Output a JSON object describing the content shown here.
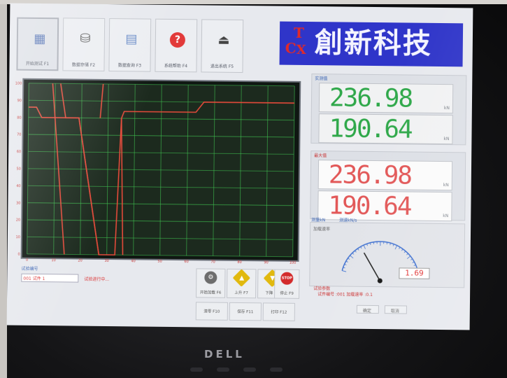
{
  "toolbar": {
    "buttons": [
      {
        "label": "开始测试 F1",
        "icon": "chart-icon",
        "symbol": "▦"
      },
      {
        "label": "数据存储 F2",
        "icon": "disk-icon",
        "symbol": "⛁"
      },
      {
        "label": "数据查询 F3",
        "icon": "document-icon",
        "symbol": "▤"
      },
      {
        "label": "系统帮助 F4",
        "icon": "help-icon",
        "symbol": "?"
      },
      {
        "label": "退出系统 F5",
        "icon": "exit-icon",
        "symbol": "⏏"
      }
    ]
  },
  "brand": {
    "logo_letters": [
      "T",
      "C",
      "X"
    ],
    "name": "創新科技"
  },
  "chart_data": {
    "type": "line",
    "title": "",
    "xlabel": "",
    "ylabel": "",
    "xlim": [
      0,
      100
    ],
    "ylim": [
      0,
      100
    ],
    "background": "#1c2a1e",
    "grid": true,
    "grid_color": "#3fbf4f",
    "x_ticks": [
      0,
      10,
      20,
      30,
      40,
      50,
      60,
      70,
      80,
      90,
      100
    ],
    "y_ticks": [
      0,
      10,
      20,
      30,
      40,
      50,
      60,
      70,
      80,
      90,
      100
    ],
    "series": [
      {
        "color": "#e54a3a",
        "points": [
          [
            0,
            86
          ],
          [
            3,
            86
          ],
          [
            5,
            80
          ],
          [
            10,
            80
          ],
          [
            19,
            80
          ],
          [
            27,
            0
          ],
          [
            33,
            0
          ],
          [
            35,
            80
          ],
          [
            36,
            84
          ],
          [
            63,
            84
          ],
          [
            66,
            90
          ],
          [
            100,
            90
          ]
        ]
      },
      {
        "color": "#e54a3a",
        "points": [
          [
            9,
            100
          ],
          [
            12,
            40
          ],
          [
            14,
            0
          ]
        ]
      },
      {
        "color": "#e54a3a",
        "points": [
          [
            12,
            100
          ],
          [
            14,
            80
          ],
          [
            19,
            80
          ],
          [
            27,
            0
          ]
        ]
      },
      {
        "color": "#e54a3a",
        "points": [
          [
            27,
            80
          ],
          [
            28,
            100
          ]
        ]
      },
      {
        "color": "#e54a3a",
        "points": [
          [
            35,
            80
          ],
          [
            36,
            0
          ]
        ]
      }
    ]
  },
  "panel_measured": {
    "title": "实测值",
    "value1": "236.98",
    "value2": "190.64",
    "unit": "kN"
  },
  "panel_max": {
    "title": "最大值",
    "value1": "236.98",
    "value2": "190.64",
    "unit": "kN"
  },
  "gauge": {
    "label1": "测量kN",
    "label2": "测速kN/s",
    "sub_label": "加载速率",
    "readout": "1.69",
    "value_fraction": 0.3,
    "bottom_title": "试验参数",
    "bottom_text": "试件编号 :001 加载速率 :0.1",
    "btn1": "确定",
    "btn2": "取消"
  },
  "bottom_left": {
    "label": "试验编号",
    "field": "001 试件 1",
    "status": "试验进行中..."
  },
  "actions": [
    {
      "label": "开始加载 F6",
      "icon": "gear-icon",
      "symbol": "⚙",
      "color": "#6d6d6d"
    },
    {
      "label": "上升 F7",
      "icon": "up-arrow-icon",
      "symbol": "▲",
      "color": "#e1b90e"
    },
    {
      "label": "下降 F8",
      "icon": "down-arrow-icon",
      "symbol": "▼",
      "color": "#e1b90e"
    },
    {
      "label": "停止 F9",
      "icon": "stop-icon",
      "symbol": "STOP",
      "color": "#d32b2b"
    }
  ],
  "wide_buttons": [
    "清零 F10",
    "保存 F11",
    "打印 F12"
  ],
  "monitor": {
    "brand": "DELL"
  }
}
